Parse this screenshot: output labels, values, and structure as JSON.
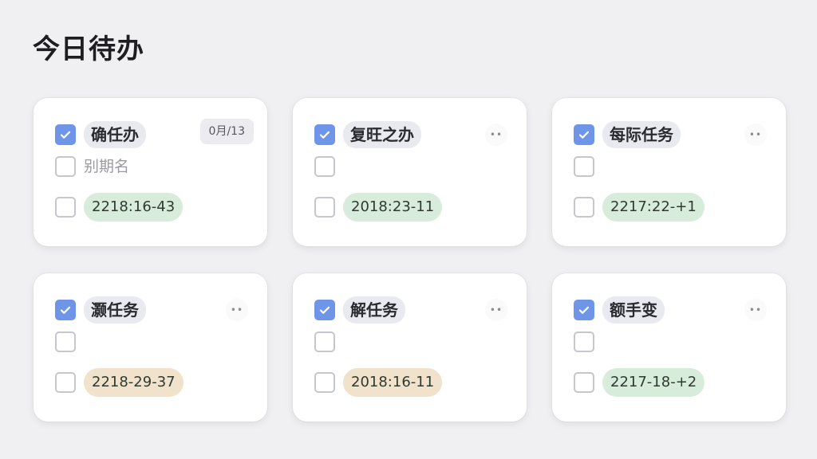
{
  "header": {
    "title": "今日待办"
  },
  "cards": [
    {
      "title": "确任办",
      "checked": true,
      "badge": "0月/13",
      "subtext": "别期名",
      "date": "2218:16-43",
      "date_color": "green"
    },
    {
      "title": "复旺之办",
      "checked": true,
      "more": "••",
      "date": "2018:23-11",
      "date_color": "green"
    },
    {
      "title": "每际任务",
      "checked": true,
      "more": "••",
      "date": "2217:22-+1",
      "date_color": "green"
    },
    {
      "title": "灏任务",
      "checked": true,
      "more": "••",
      "date": "2218-29-37",
      "date_color": "beige"
    },
    {
      "title": "解任务",
      "checked": true,
      "more": "••",
      "date": "2018:16-11",
      "date_color": "beige"
    },
    {
      "title": "额手变",
      "checked": true,
      "more": "••",
      "date": "2217-18-+2",
      "date_color": "green"
    }
  ],
  "colors": {
    "accent": "#6e95e8",
    "date_green": "#d8ecdc",
    "date_beige": "#f1e2cc",
    "background": "#f0f0f3"
  },
  "icons": {
    "check": "check-icon",
    "more": "more-dots-icon"
  }
}
